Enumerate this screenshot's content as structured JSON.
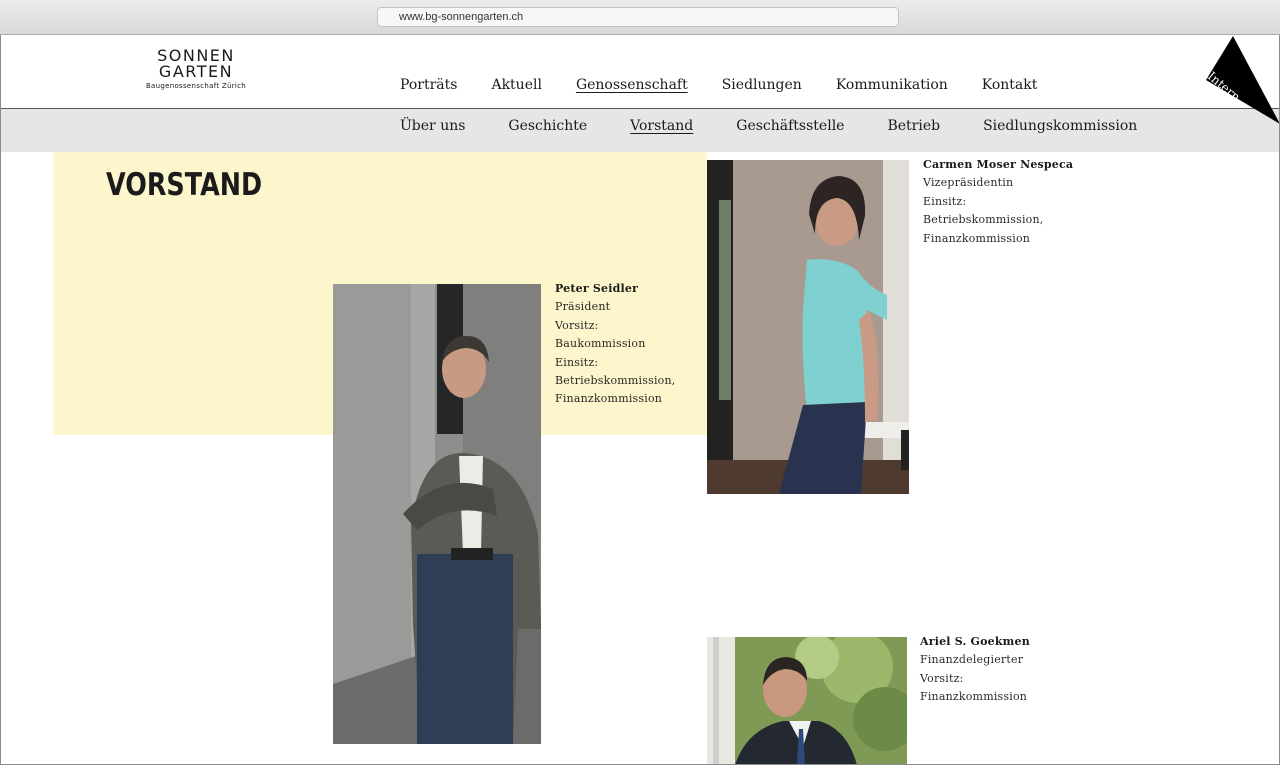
{
  "browser": {
    "url": "www.bg-sonnengarten.ch"
  },
  "logo": {
    "line1": "SONNEN",
    "line2": "GARTEN",
    "subtitle": "Baugenossenschaft Zürich"
  },
  "main_nav": [
    "Porträts",
    "Aktuell",
    "Genossenschaft",
    "Siedlungen",
    "Kommunikation",
    "Kontakt"
  ],
  "main_nav_active": "Genossenschaft",
  "sub_nav": [
    "Über uns",
    "Geschichte",
    "Vorstand",
    "Geschäftsstelle",
    "Betrieb",
    "Siedlungskommission"
  ],
  "sub_nav_active": "Vorstand",
  "intern": {
    "label": "Intern"
  },
  "page": {
    "heading": "VORSTAND"
  },
  "colors": {
    "accent_yellow": "#fdf5cb",
    "text": "#1a1a1a",
    "subnav_bg": "#e6e6e7",
    "intern_black": "#000000"
  },
  "members": [
    {
      "name": "Peter Seidler",
      "role": "Präsident",
      "lines": [
        "Vorsitz:",
        "Baukommission",
        "Einsitz:",
        "Betriebskommission,",
        "Finanzkommission"
      ]
    },
    {
      "name": "Carmen Moser Nespeca",
      "role": "Vizepräsidentin",
      "lines": [
        "Einsitz:",
        "Betriebskommission,",
        "Finanzkommission"
      ]
    },
    {
      "name": "Ariel S. Goekmen",
      "role": "Finanzdelegierter",
      "lines": [
        "Vorsitz:",
        "Finanzkommission"
      ]
    }
  ]
}
